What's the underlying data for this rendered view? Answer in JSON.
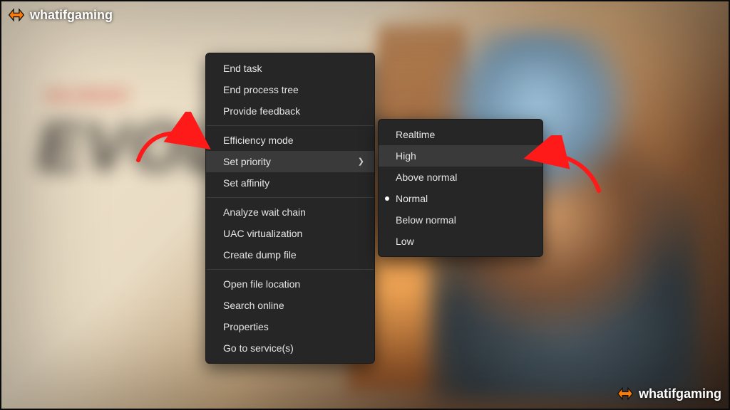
{
  "watermark": {
    "text": "whatifgaming"
  },
  "background": {
    "subtitle": "VALORANT",
    "big_text": "EVOLUTION"
  },
  "context_menu": {
    "groups": [
      [
        {
          "label": "End task"
        },
        {
          "label": "End process tree"
        },
        {
          "label": "Provide feedback"
        }
      ],
      [
        {
          "label": "Efficiency mode"
        },
        {
          "label": "Set priority",
          "has_submenu": true,
          "hovered": true
        },
        {
          "label": "Set affinity"
        }
      ],
      [
        {
          "label": "Analyze wait chain"
        },
        {
          "label": "UAC virtualization"
        },
        {
          "label": "Create dump file"
        }
      ],
      [
        {
          "label": "Open file location"
        },
        {
          "label": "Search online"
        },
        {
          "label": "Properties"
        },
        {
          "label": "Go to service(s)"
        }
      ]
    ]
  },
  "priority_submenu": {
    "items": [
      {
        "label": "Realtime"
      },
      {
        "label": "High",
        "hovered": true
      },
      {
        "label": "Above normal"
      },
      {
        "label": "Normal",
        "current": true
      },
      {
        "label": "Below normal"
      },
      {
        "label": "Low"
      }
    ]
  },
  "annotations": {
    "arrow_color": "#ff1a1a"
  }
}
